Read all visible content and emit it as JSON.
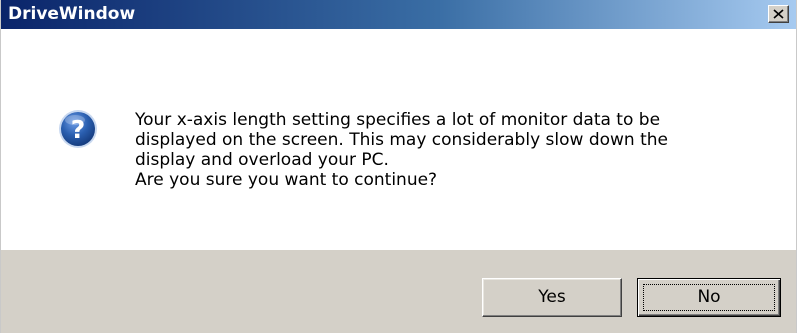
{
  "window": {
    "title": "DriveWindow",
    "close_icon": "close-x-icon"
  },
  "dialog": {
    "icon": "question-icon",
    "icon_glyph": "?",
    "message_lines": [
      "Your x-axis length setting specifies a lot of monitor data to be",
      "displayed on the screen. This may considerably slow down the",
      "display and overload your PC.",
      "Are you sure you want to continue?"
    ]
  },
  "buttons": {
    "yes_label": "Yes",
    "no_label": "No"
  },
  "colors": {
    "titlebar_start": "#0a246a",
    "titlebar_end": "#a6caf0",
    "footer_bg": "#d4d0c8",
    "icon_blue": "#2a5fb0"
  }
}
